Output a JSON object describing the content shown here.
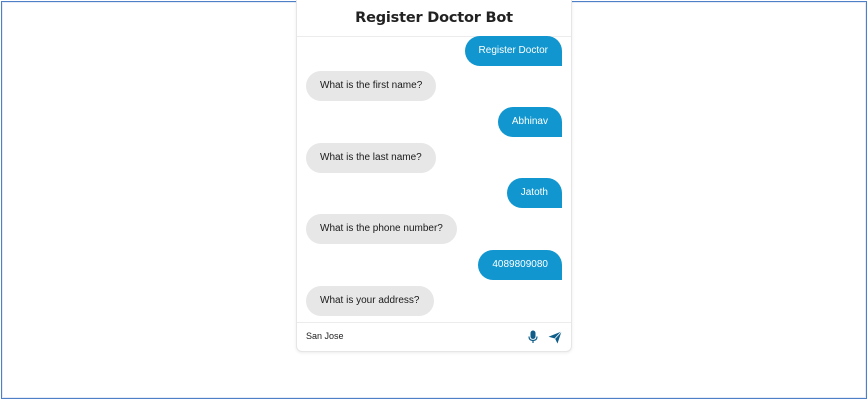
{
  "chat": {
    "title": "Register Doctor Bot",
    "messages": [
      {
        "sender": "user",
        "text": "Register Doctor"
      },
      {
        "sender": "bot",
        "text": "What is the first name?"
      },
      {
        "sender": "user",
        "text": "Abhinav"
      },
      {
        "sender": "bot",
        "text": "What is the last name?"
      },
      {
        "sender": "user",
        "text": "Jatoth"
      },
      {
        "sender": "bot",
        "text": "What is the phone number?"
      },
      {
        "sender": "user",
        "text": "4089809080"
      },
      {
        "sender": "bot",
        "text": "What is your address?"
      }
    ]
  },
  "input": {
    "value": "San Jose"
  },
  "icons": {
    "mic": "microphone-icon",
    "send": "send-icon"
  },
  "colors": {
    "user_bubble": "#1196cf",
    "bot_bubble": "#e7e7e7",
    "icon": "#0f5e8a",
    "frame_border": "#4f7fc6"
  }
}
